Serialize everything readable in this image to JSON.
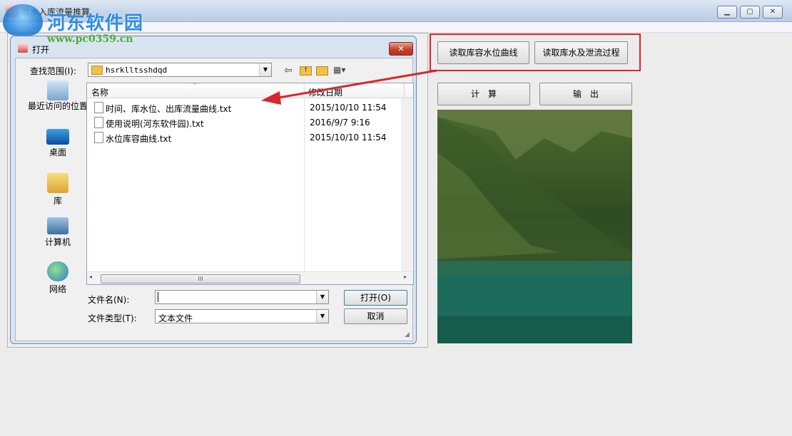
{
  "window": {
    "title": "泄水入库流量推算"
  },
  "watermark": {
    "name": "河东软件园",
    "url": "www.pc0359.cn"
  },
  "right_panel": {
    "btn_read_curve": "读取库容水位曲线",
    "btn_read_process": "读取库水及泄流过程",
    "btn_calc": "计　算",
    "btn_output": "输　出"
  },
  "dialog": {
    "title": "打开",
    "lookin_label": "查找范围(I):",
    "lookin_value": "hsrklltsshdqd",
    "places": [
      "最近访问的位置",
      "桌面",
      "库",
      "计算机",
      "网络"
    ],
    "columns": {
      "name": "名称",
      "date": "修改日期"
    },
    "files": [
      {
        "name": "时间、库水位、出库流量曲线.txt",
        "date": "2015/10/10 11:54"
      },
      {
        "name": "使用说明(河东软件园).txt",
        "date": "2016/9/7 9:16"
      },
      {
        "name": "水位库容曲线.txt",
        "date": "2015/10/10 11:54"
      }
    ],
    "filename_label": "文件名(N):",
    "filename_value": "",
    "filetype_label": "文件类型(T):",
    "filetype_value": "文本文件",
    "open_btn": "打开(O)",
    "cancel_btn": "取消",
    "hscroll_thumb": "III"
  },
  "colors": {
    "highlight": "#d9262b",
    "arrow": "#d9262b"
  }
}
